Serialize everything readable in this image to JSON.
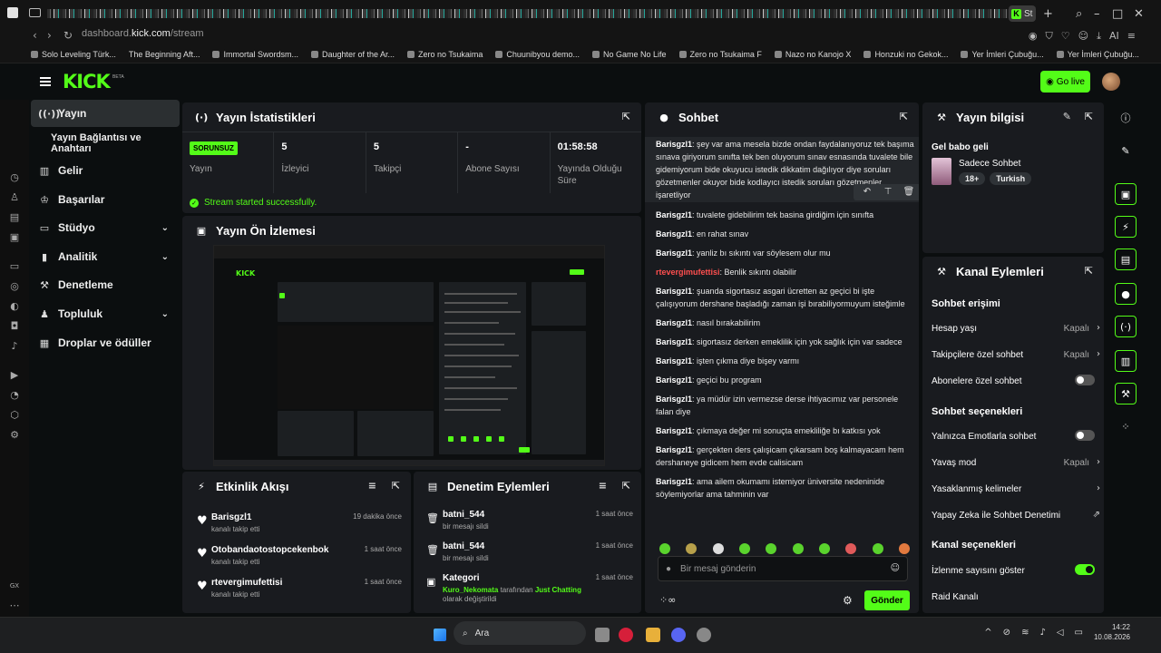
{
  "browser": {
    "url_host": "dashboard.",
    "url_domain": "kick.com",
    "url_path": "/stream",
    "active_tab": "St",
    "bookmarks": [
      "Solo Leveling Türk...",
      "The Beginning Aft...",
      "Immortal Swordsm...",
      "Daughter of the Ar...",
      "Zero no Tsukaima",
      "Chuunibyou demo...",
      "No Game No Life",
      "Zero no Tsukaima F",
      "Nazo no Kanojo X",
      "Honzuki no Gekok...",
      "Yer İmleri Çubuğu...",
      "Yer İmleri Çubuğu..."
    ],
    "toolbar_ai": "AI"
  },
  "header": {
    "logo": "KICK",
    "beta": "BETA",
    "go_live": "Go live"
  },
  "sidebar": {
    "items": [
      {
        "label": "Yayın",
        "icon": "broadcast-icon"
      },
      {
        "label": "Yayın Bağlantısı ve Anahtarı"
      },
      {
        "label": "Gelir",
        "icon": "chart-icon"
      },
      {
        "label": "Başarılar",
        "icon": "trophy-icon"
      },
      {
        "label": "Stüdyo",
        "icon": "monitor-icon"
      },
      {
        "label": "Analitik",
        "icon": "bar-chart-icon"
      },
      {
        "label": "Denetleme",
        "icon": "wrench-icon"
      },
      {
        "label": "Topluluk",
        "icon": "people-icon"
      },
      {
        "label": "Droplar ve ödüller",
        "icon": "gift-icon"
      }
    ]
  },
  "stats_panel": {
    "title": "Yayın İstatistikleri",
    "status_badge": "SORUNSUZ",
    "status_label": "Yayın",
    "items": [
      {
        "value": "5",
        "label": "İzleyici"
      },
      {
        "value": "5",
        "label": "Takipçi"
      },
      {
        "value": "-",
        "label": "Abone Sayısı"
      },
      {
        "value": "01:58:58",
        "label": "Yayında Olduğu Süre"
      }
    ],
    "success": "Stream started successfully."
  },
  "preview_panel": {
    "title": "Yayın Ön İzlemesi"
  },
  "activity_panel": {
    "title": "Etkinlik Akışı",
    "items": [
      {
        "name": "Barisgzl1",
        "sub": "kanalı takip etti",
        "time": "19 dakika önce"
      },
      {
        "name": "Otobandaotostopcekenbok",
        "sub": "kanalı takip etti",
        "time": "1 saat önce"
      },
      {
        "name": "rtevergimufettisi",
        "sub": "kanalı takip etti",
        "time": "1 saat önce"
      }
    ]
  },
  "mod_panel": {
    "title": "Denetim Eylemleri",
    "items": [
      {
        "name": "batni_544",
        "sub": "bir mesajı sildi",
        "time": "1 saat önce"
      },
      {
        "name": "batni_544",
        "sub": "bir mesajı sildi",
        "time": "1 saat önce"
      },
      {
        "name": "Kategori",
        "sub_user": "Kuro_Nekomata",
        "sub_mid": " tarafından ",
        "sub_cat": "Just Chatting",
        "sub_end": " olarak değiştirildi",
        "time": "1 saat önce"
      }
    ]
  },
  "chat": {
    "title": "Sohbet",
    "messages": [
      {
        "user": "Barisgzl1",
        "text": "şey var ama mesela bizde ondan faydalanıyoruz tek başıma sınava giriyorum sınıfta tek ben oluyorum sınav esnasında tuvalete bile gidemiyorum bide okuyucu istedik dikkatim dağılıyor diye soruları gözetmenler okuyor bide kodlayıcı istedik soruları gözetmenler işaretliyor"
      },
      {
        "user": "Barisgzl1",
        "text": "tuvalete gidebilirim tek basina girdiğim için sınıfta"
      },
      {
        "user": "Barisgzl1",
        "text": "en rahat sınav"
      },
      {
        "user": "Barisgzl1",
        "text": "yanliz bı sıkıntı var söylesem olur mu"
      },
      {
        "user": "rtevergimufettisi",
        "text": "Benlik sıkıntı olabilir",
        "red": true
      },
      {
        "user": "Barisgzl1",
        "text": "şuanda sigortasız asgari ücretten az geçici bi işte çalışıyorum dershane başladığı zaman işi bırabiliyormuyum isteğimle"
      },
      {
        "user": "Barisgzl1",
        "text": "nasıl bırakabilirim"
      },
      {
        "user": "Barisgzl1",
        "text": "sigortasız derken emeklilik için yok sağlık için var sadece"
      },
      {
        "user": "Barisgzl1",
        "text": "işten çıkma diye bişey varmı"
      },
      {
        "user": "Barisgzl1",
        "text": "geçici bu program"
      },
      {
        "user": "Barisgzl1",
        "text": "ya müdür izin vermezse derse ihtiyacımız var personele falan diye"
      },
      {
        "user": "Barisgzl1",
        "text": "çıkmaya değer mi sonuçta emekliliğe bı katkısı yok"
      },
      {
        "user": "Barisgzl1",
        "text": "gerçekten ders çalışicam çıkarsam boş kalmayacam hem dershaneye gidicem hem evde calisicam"
      },
      {
        "user": "Barisgzl1",
        "text": "ama ailem okumamı istemiyor üniversite nedeninide söylemiyorlar ama tahminin var"
      }
    ],
    "input_placeholder": "Bir mesaj gönderin",
    "send": "Gönder"
  },
  "info_panel": {
    "title": "Yayın bilgisi",
    "stream_title": "Gel babo geli",
    "category": "Sadece Sohbet",
    "tags": [
      "18+",
      "Turkish"
    ]
  },
  "channel_panel": {
    "title": "Kanal Eylemleri",
    "sec_access": "Sohbet erişimi",
    "account_age": "Hesap yaşı",
    "account_age_val": "Kapalı",
    "followers_only": "Takipçilere özel sohbet",
    "followers_only_val": "Kapalı",
    "subs_only": "Abonelere özel sohbet",
    "sec_options": "Sohbet seçenekleri",
    "emotes_only": "Yalnızca Emotlarla sohbet",
    "slow_mode": "Yavaş mod",
    "slow_mode_val": "Kapalı",
    "banned_words": "Yasaklanmış kelimeler",
    "ai_mod": "Yapay Zeka ile Sohbet Denetimi",
    "sec_channel": "Kanal seçenekleri",
    "show_viewers": "İzlenme sayısını göster",
    "raid": "Raid Kanalı"
  },
  "taskbar": {
    "search": "Ara",
    "time": "14:22",
    "date": "10.08.2026"
  },
  "gx_label": "GX",
  "accent": "#53fc18"
}
